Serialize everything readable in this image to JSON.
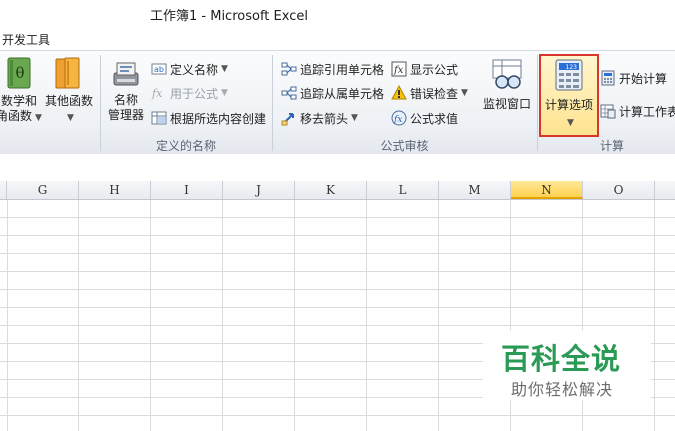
{
  "window": {
    "title": "工作簿1  -  Microsoft Excel"
  },
  "tabs": {
    "developer": "开发工具"
  },
  "ribbon": {
    "fn_lib": {
      "math_label_1": "数学和",
      "math_label_2": "角函数",
      "other_label": "其他函数"
    },
    "defined_names": {
      "name_manager_1": "名称",
      "name_manager_2": "管理器",
      "define_name": "定义名称",
      "use_in_formula": "用于公式",
      "create_from_selection": "根据所选内容创建",
      "group_label": "定义的名称"
    },
    "auditing": {
      "trace_precedents": "追踪引用单元格",
      "trace_dependents": "追踪从属单元格",
      "remove_arrows": "移去箭头",
      "show_formulas": "显示公式",
      "error_checking": "错误检查",
      "evaluate_formula": "公式求值",
      "watch_window": "监视窗口",
      "group_label": "公式审核"
    },
    "calculation": {
      "calc_options": "计算选项",
      "calc_now": "开始计算",
      "calc_sheet": "计算工作表",
      "group_label": "计算",
      "calc_icon_digits": "123"
    }
  },
  "grid": {
    "columns": [
      "G",
      "H",
      "I",
      "J",
      "K",
      "L",
      "M",
      "N",
      "O"
    ],
    "selected_column": "N"
  },
  "watermark": {
    "title": "百科全说",
    "subtitle": "助你轻松解决"
  },
  "colors": {
    "highlight_border": "#d9362b",
    "selected_header": "#ffd24f",
    "watermark": "#2b9a55"
  }
}
